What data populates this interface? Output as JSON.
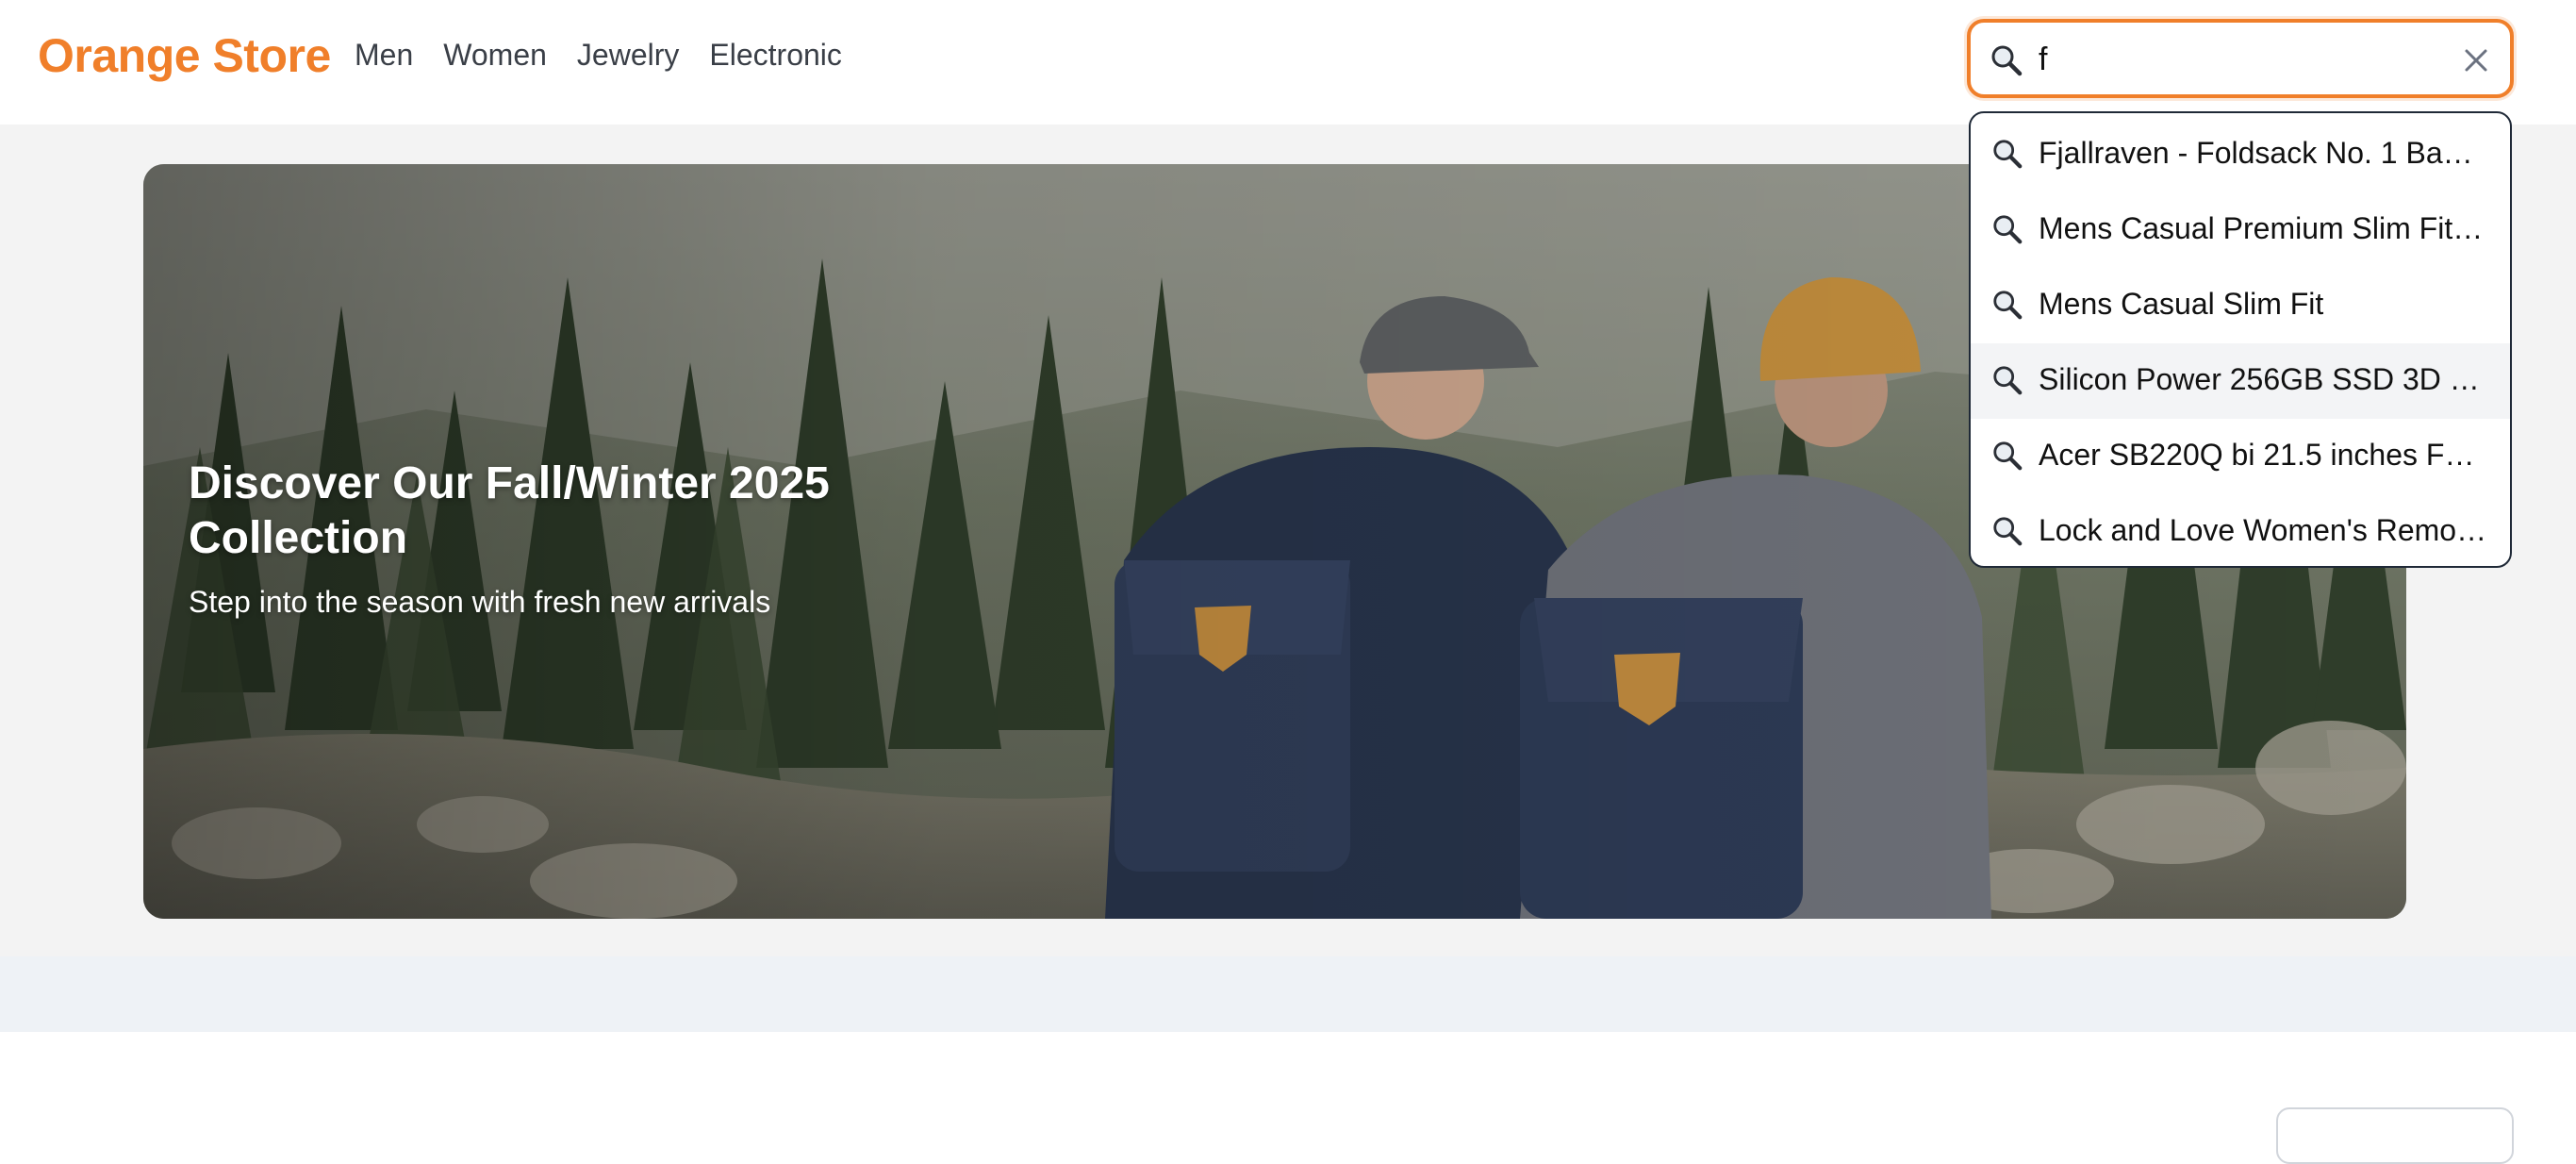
{
  "brand": {
    "name": "Orange Store",
    "color": "#f07f2a"
  },
  "nav": {
    "items": [
      {
        "label": "Men"
      },
      {
        "label": "Women"
      },
      {
        "label": "Jewelry"
      },
      {
        "label": "Electronic"
      }
    ]
  },
  "search": {
    "value": "f",
    "placeholder": "",
    "accent": "#f07f2a",
    "icon": "search-icon",
    "clear_icon": "close-icon"
  },
  "suggestions": {
    "items": [
      {
        "label": "Fjallraven - Foldsack No. 1 Ba…"
      },
      {
        "label": "Mens Casual Premium Slim Fit…"
      },
      {
        "label": "Mens Casual Slim Fit"
      },
      {
        "label": "Silicon Power 256GB SSD 3D …"
      },
      {
        "label": "Acer SB220Q bi 21.5 inches F…"
      },
      {
        "label": "Lock and Love Women's Remo…"
      }
    ],
    "highlighted_index": 3
  },
  "hero": {
    "title": "Discover Our Fall/Winter 2025 Collection",
    "subtitle": "Step into the season with fresh new arrivals"
  }
}
